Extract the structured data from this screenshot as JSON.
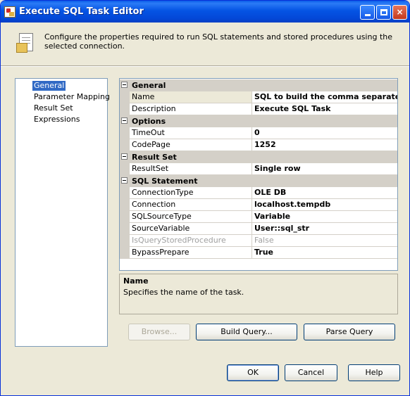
{
  "window": {
    "title": "Execute SQL Task Editor",
    "minimize_label": "",
    "maximize_label": "",
    "close_label": "×"
  },
  "header": {
    "description": "Configure the properties required to run SQL statements and stored procedures using the selected connection."
  },
  "nav": {
    "items": [
      {
        "label": "General",
        "selected": true
      },
      {
        "label": "Parameter Mapping",
        "selected": false
      },
      {
        "label": "Result Set",
        "selected": false
      },
      {
        "label": "Expressions",
        "selected": false
      }
    ]
  },
  "grid": {
    "categories": [
      {
        "label": "General",
        "properties": [
          {
            "name": "Name",
            "value": "SQL to build the comma separated task"
          },
          {
            "name": "Description",
            "value": "Execute SQL Task"
          }
        ]
      },
      {
        "label": "Options",
        "properties": [
          {
            "name": "TimeOut",
            "value": "0"
          },
          {
            "name": "CodePage",
            "value": "1252"
          }
        ]
      },
      {
        "label": "Result Set",
        "properties": [
          {
            "name": "ResultSet",
            "value": "Single row"
          }
        ]
      },
      {
        "label": "SQL Statement",
        "properties": [
          {
            "name": "ConnectionType",
            "value": "OLE DB"
          },
          {
            "name": "Connection",
            "value": "localhost.tempdb"
          },
          {
            "name": "SQLSourceType",
            "value": "Variable"
          },
          {
            "name": "SourceVariable",
            "value": "User::sql_str"
          },
          {
            "name": "IsQueryStoredProcedure",
            "value": "False"
          },
          {
            "name": "BypassPrepare",
            "value": "True"
          }
        ]
      }
    ]
  },
  "description_panel": {
    "title": "Name",
    "text": "Specifies the name of the task."
  },
  "buttons": {
    "browse": "Browse...",
    "build_query": "Build Query...",
    "parse_query": "Parse Query",
    "ok": "OK",
    "cancel": "Cancel",
    "help": "Help"
  },
  "colors": {
    "titlebar": "#0554e4",
    "selection": "#316ac5",
    "window_bg": "#ece9d8"
  }
}
